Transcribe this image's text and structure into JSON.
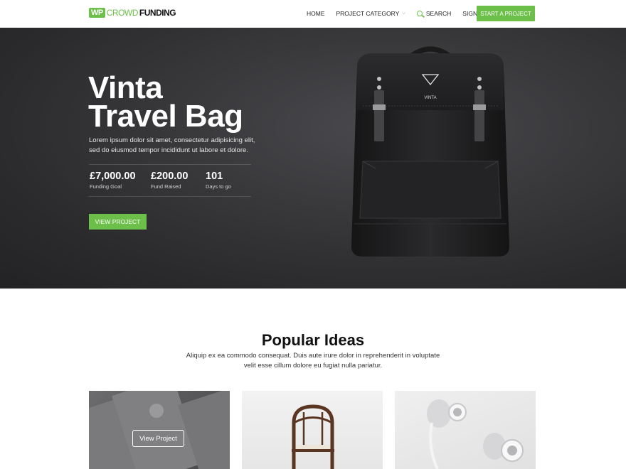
{
  "header": {
    "logo": {
      "wp": "WP",
      "crowd": "CROWD",
      "funding": "FUNDING"
    },
    "nav": {
      "home": "HOME",
      "project_category": "PROJECT CATEGORY",
      "search": "SEARCH",
      "signup": "SIGNUP"
    },
    "start_project": "START A PROJECT"
  },
  "hero": {
    "title_line1": "Vinta",
    "title_line2": "Travel Bag",
    "description": "Lorem ipsum dolor sit amet, consectetur adipisicing elit, sed do eiusmod tempor incididunt ut labore et dolore.",
    "stats": [
      {
        "value": "£7,000.00",
        "label": "Funding Goal"
      },
      {
        "value": "£200.00",
        "label": "Fund Raised"
      },
      {
        "value": "101",
        "label": "Days to go"
      }
    ],
    "view_project": "VIEW PROJECT",
    "brand_mark": "VINTA"
  },
  "popular": {
    "title": "Popular Ideas",
    "description": "Aliquip ex ea commodo consequat. Duis aute irure dolor in reprehenderit in voluptate velit esse cillum dolore eu fugiat nulla pariatur.",
    "card_button": "View Project"
  },
  "colors": {
    "accent": "#6cc04a",
    "hero_bg": "#333336"
  }
}
